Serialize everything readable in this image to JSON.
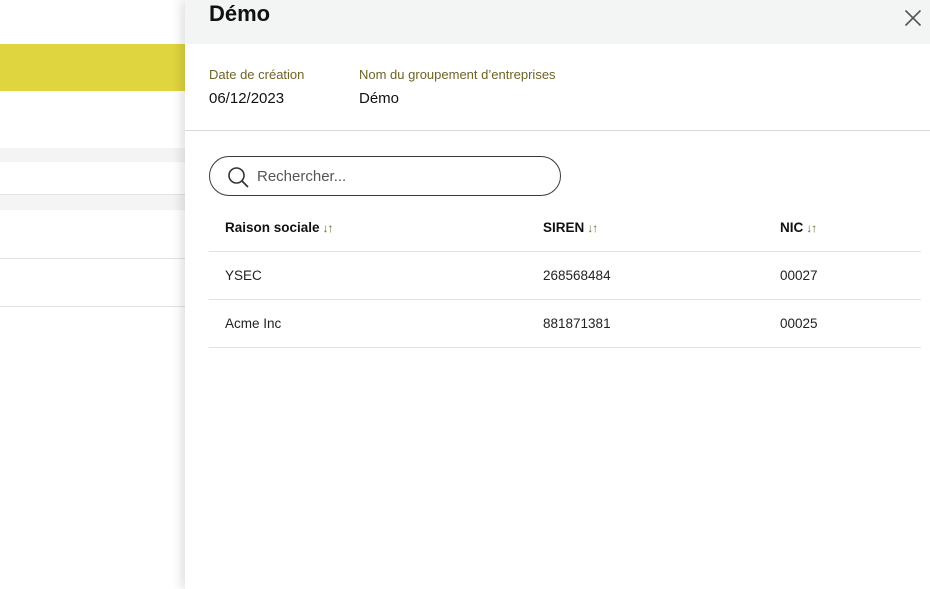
{
  "drawer": {
    "title": "Démo",
    "meta": {
      "date_label": "Date de création",
      "date_value": "06/12/2023",
      "name_label": "Nom du groupement d’entreprises",
      "name_value": "Démo"
    },
    "search": {
      "placeholder": "Rechercher..."
    },
    "table": {
      "columns": [
        {
          "label": "Raison sociale",
          "sort_icon": "↓↑"
        },
        {
          "label": "SIREN",
          "sort_icon": "↓↑"
        },
        {
          "label": "NIC",
          "sort_icon": "↓↑"
        }
      ],
      "rows": [
        {
          "raison_sociale": "YSEC",
          "siren": "268568484",
          "nic": "00027"
        },
        {
          "raison_sociale": "Acme Inc",
          "siren": "881871381",
          "nic": "00025"
        }
      ]
    }
  },
  "colors": {
    "accent_yellow": "#dfd53f",
    "label_olive": "#6f6326",
    "header_bg": "#f3f5f4"
  },
  "icons": {
    "close": "close-icon",
    "search": "search-icon",
    "sort": "sort-icon"
  }
}
